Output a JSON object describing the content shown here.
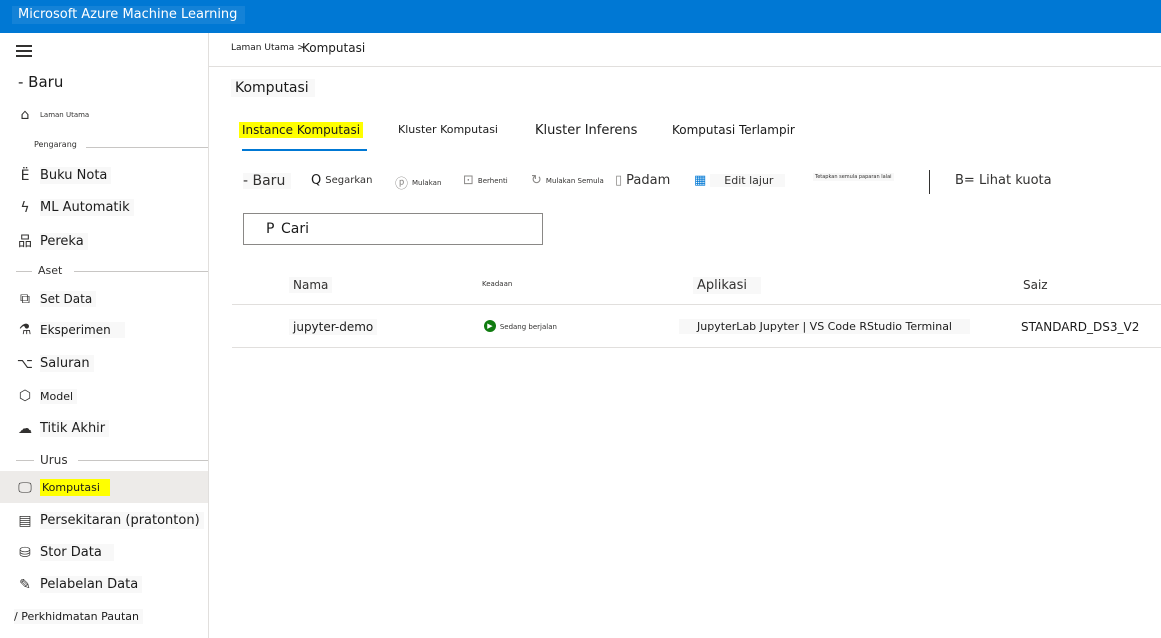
{
  "app": {
    "title": "Microsoft Azure Machine Learning"
  },
  "sidebar": {
    "new_label": "- Baru",
    "home_label": "Laman Utama",
    "sections": {
      "author": "Pengarang",
      "assets": "Aset",
      "manage": "Urus"
    },
    "author_items": [
      {
        "label": "Buku Nota",
        "icon": "notebook-icon"
      },
      {
        "label": "ML Automatik",
        "icon": "automl-icon"
      },
      {
        "label": "Pereka",
        "icon": "designer-icon"
      }
    ],
    "asset_items": [
      {
        "label": "Set Data",
        "icon": "dataset-icon"
      },
      {
        "label": "Eksperimen",
        "icon": "experiment-icon"
      },
      {
        "label": "Saluran",
        "icon": "pipeline-icon"
      },
      {
        "label": "Model",
        "icon": "model-icon"
      },
      {
        "label": "Titik Akhir",
        "icon": "endpoint-icon"
      }
    ],
    "manage_items": [
      {
        "label": "Komputasi",
        "icon": "compute-icon"
      },
      {
        "label": "Persekitaran (pratonton)",
        "icon": "environment-icon"
      },
      {
        "label": "Stor Data",
        "icon": "datastore-icon"
      },
      {
        "label": "Pelabelan Data",
        "icon": "labeling-icon"
      },
      {
        "label": "/ Perkhidmatan Pautan",
        "icon": "linked-service-icon"
      }
    ]
  },
  "breadcrumb": {
    "home": "Laman Utama >",
    "current": "Komputasi"
  },
  "page": {
    "title": "Komputasi"
  },
  "tabs": [
    {
      "label": "Instance Komputasi"
    },
    {
      "label": "Kluster Komputasi"
    },
    {
      "label": "Kluster Inferens"
    },
    {
      "label": "Komputasi Terlampir"
    }
  ],
  "toolbar": {
    "new": "- Baru",
    "refresh": "Segarkan",
    "start": "Mulakan",
    "stop": "Berhenti",
    "restart": "Mulakan Semula",
    "delete": "Padam",
    "edit_columns": "Edit lajur",
    "reset_view": "Tetapkan semula paparan lalai",
    "view_quota": "B= Lihat kuota"
  },
  "search": {
    "placeholder": "Cari",
    "icon_glyph": "P"
  },
  "table": {
    "headers": {
      "name": "Nama",
      "state": "Keadaan",
      "apps": "Aplikasi",
      "size": "Saiz"
    },
    "rows": [
      {
        "name": "jupyter-demo",
        "state": "Sedang berjalan",
        "apps": "JupyterLab Jupyter | VS Code RStudio Terminal",
        "size": "STANDARD_DS3_V2"
      }
    ]
  },
  "colors": {
    "brand": "#0078d4",
    "highlight": "#ffff00",
    "running": "#107c10"
  }
}
